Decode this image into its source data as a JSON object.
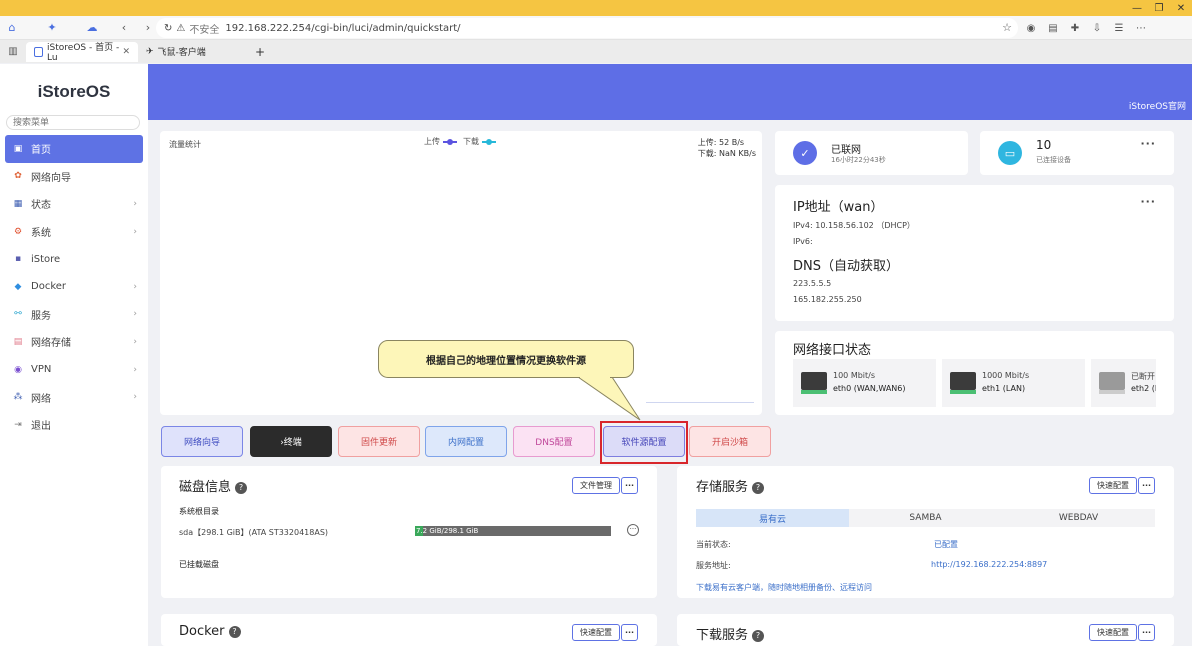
{
  "browser": {
    "url": "192.168.222.254/cgi-bin/luci/admin/quickstart/",
    "security": "不安全",
    "tabs": [
      {
        "label": "iStoreOS - 首页 - Lu"
      },
      {
        "label": "飞鼠-客户端"
      }
    ]
  },
  "sidebar": {
    "logo": "iStoreOS",
    "search_placeholder": "搜索菜单",
    "items": [
      {
        "label": "首页",
        "icon": "home-icon"
      },
      {
        "label": "网络向导",
        "icon": "wizard-icon"
      },
      {
        "label": "状态",
        "icon": "status-icon"
      },
      {
        "label": "系统",
        "icon": "gear-icon"
      },
      {
        "label": "iStore",
        "icon": "store-icon"
      },
      {
        "label": "Docker",
        "icon": "docker-icon"
      },
      {
        "label": "服务",
        "icon": "service-icon"
      },
      {
        "label": "网络存储",
        "icon": "storage-icon"
      },
      {
        "label": "VPN",
        "icon": "vpn-icon"
      },
      {
        "label": "网络",
        "icon": "network-icon"
      },
      {
        "label": "退出",
        "icon": "logout-icon"
      }
    ]
  },
  "header": {
    "official_link": "iStoreOS官网"
  },
  "traffic": {
    "title": "流量统计",
    "legend_up": "上传",
    "legend_down": "下载",
    "upload_speed": "上传: 52 B/s",
    "download_speed": "下载: NaN KB/s",
    "up_color": "#5b54e0",
    "down_color": "#27b8d9"
  },
  "quick_buttons": [
    {
      "label": "网络向导"
    },
    {
      "label": "›终端"
    },
    {
      "label": "固件更新"
    },
    {
      "label": "内网配置"
    },
    {
      "label": "DNS配置"
    },
    {
      "label": "软件源配置"
    },
    {
      "label": "开启沙箱"
    }
  ],
  "callout": {
    "text": "根据自己的地理位置情况更换软件源"
  },
  "status": {
    "connected": "已联网",
    "uptime": "16小时22分43秒",
    "devices_count": "10",
    "devices_label": "已连接设备"
  },
  "ip": {
    "title": "IP地址（wan）",
    "ipv4": "IPv4: 10.158.56.102 （DHCP）",
    "ipv6": "IPv6:",
    "dns_title": "DNS（自动获取）",
    "dns1": "223.5.5.5",
    "dns2": "165.182.255.250"
  },
  "ports": {
    "title": "网络接口状态",
    "items": [
      {
        "speed": "100 Mbit/s",
        "name": "eth0 (WAN,WAN6)"
      },
      {
        "speed": "1000 Mbit/s",
        "name": "eth1 (LAN)"
      },
      {
        "speed": "已断开",
        "name": "eth2 (I"
      }
    ]
  },
  "disk": {
    "title": "磁盘信息",
    "file_mgr": "文件管理",
    "root_label": "系统根目录",
    "disk_name": "sda【298.1 GiB】(ATA ST3320418AS)",
    "usage_text": "7.2 GiB/298.1 GiB",
    "usage_fraction": 0.024,
    "mounted_label": "已挂载磁盘"
  },
  "storage": {
    "title": "存储服务",
    "quick_config": "快速配置",
    "tabs": [
      "易有云",
      "SAMBA",
      "WEBDAV"
    ],
    "status_label": "当前状态:",
    "status_value": "已配置",
    "addr_label": "服务地址:",
    "addr_value": "http://192.168.222.254:8897",
    "download_link": "下载易有云客户端，随时随地相册备份、远程访问"
  },
  "docker": {
    "title": "Docker",
    "quick_config": "快速配置"
  },
  "download": {
    "title": "下载服务",
    "quick_config": "快速配置"
  },
  "more": "···"
}
